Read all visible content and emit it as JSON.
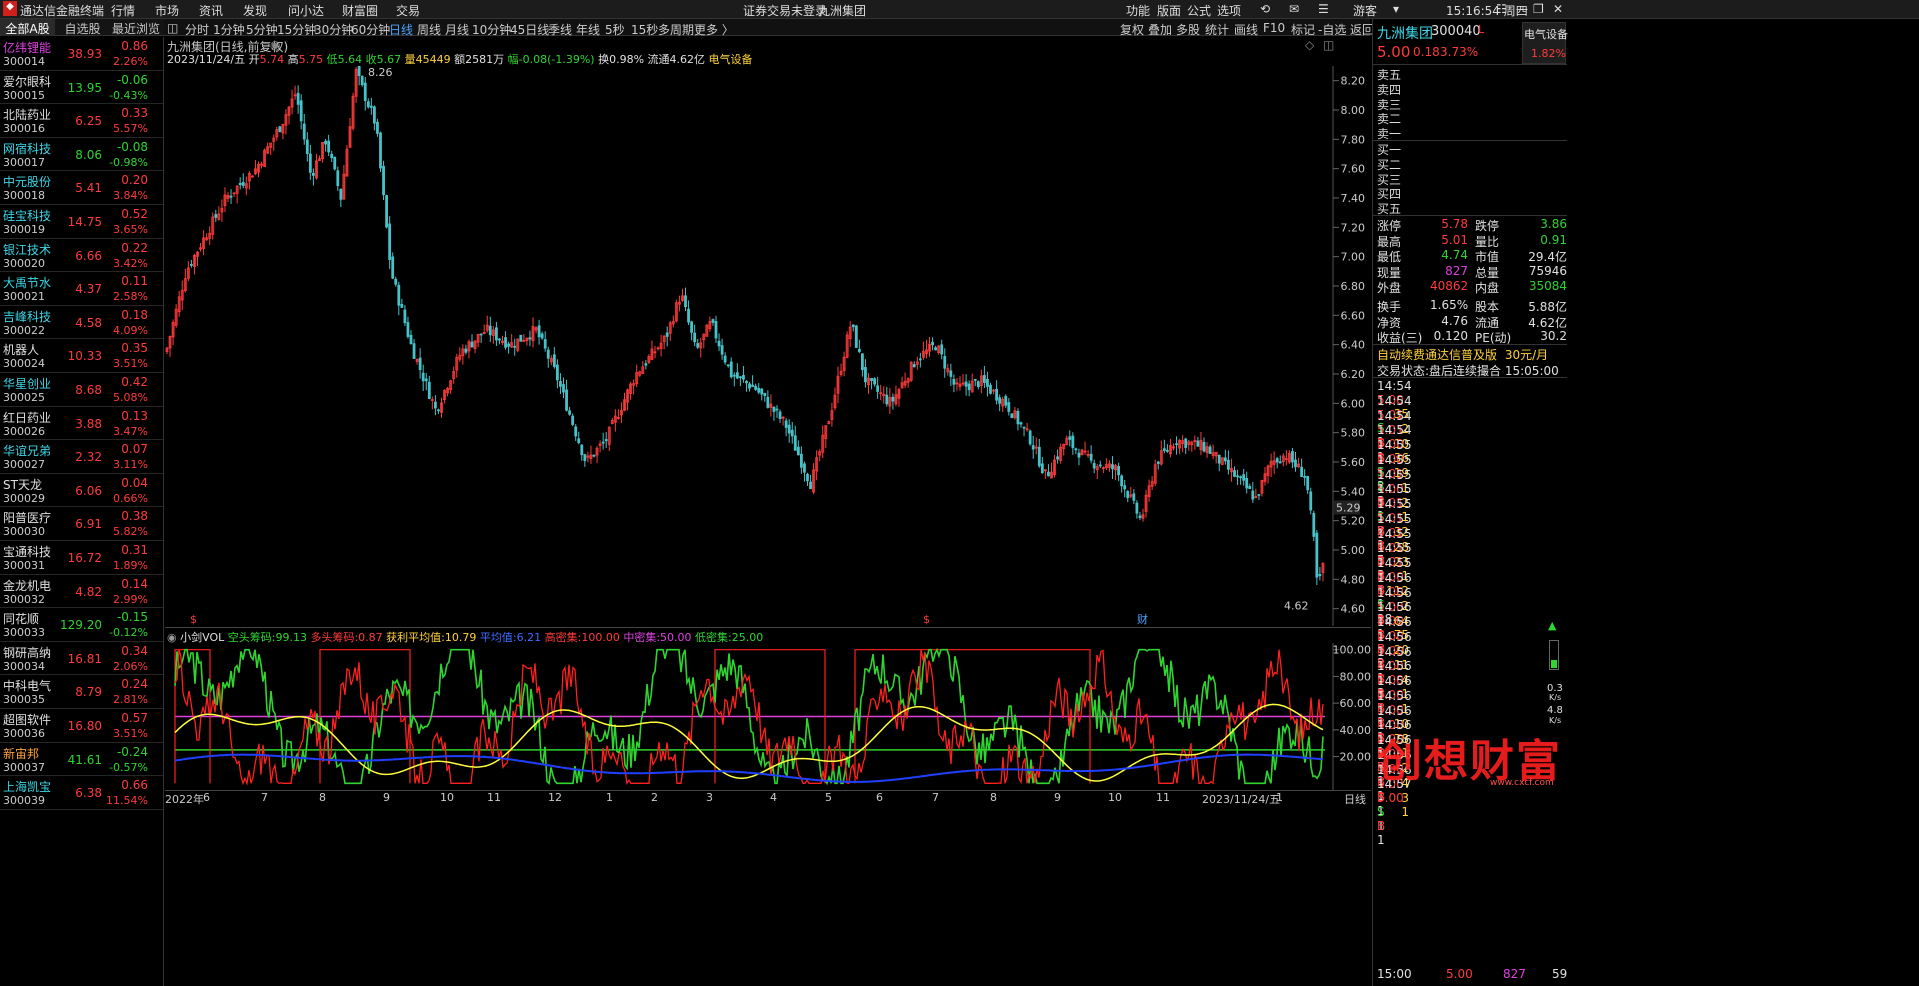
{
  "app": {
    "title": "通达信金融终端",
    "menus": [
      "行情",
      "市场",
      "资讯",
      "发现",
      "问小达",
      "财富圈",
      "交易"
    ],
    "warning": "证券交易未登录",
    "warning_stock": "九洲集团",
    "right_menus": [
      "功能",
      "版面",
      "公式",
      "选项"
    ],
    "user": "游客",
    "clock": "15:16:54 周四"
  },
  "left_tabs": [
    "全部A股",
    "自选股",
    "最近浏览"
  ],
  "stocks": [
    {
      "name": "亿纬锂能",
      "code": "300014",
      "price": "38.93",
      "change": "0.86",
      "pct": "2.26%",
      "nc": "purple",
      "dir": "up"
    },
    {
      "name": "爱尔眼科",
      "code": "300015",
      "price": "13.95",
      "change": "-0.06",
      "pct": "-0.43%",
      "nc": "white",
      "dir": "down"
    },
    {
      "name": "北陆药业",
      "code": "300016",
      "price": "6.25",
      "change": "0.33",
      "pct": "5.57%",
      "nc": "white",
      "dir": "up"
    },
    {
      "name": "网宿科技",
      "code": "300017",
      "price": "8.06",
      "change": "-0.08",
      "pct": "-0.98%",
      "nc": "cyan",
      "dir": "down"
    },
    {
      "name": "中元股份",
      "code": "300018",
      "price": "5.41",
      "change": "0.20",
      "pct": "3.84%",
      "nc": "cyan",
      "dir": "up"
    },
    {
      "name": "硅宝科技",
      "code": "300019",
      "price": "14.75",
      "change": "0.52",
      "pct": "3.65%",
      "nc": "cyan",
      "dir": "up"
    },
    {
      "name": "银江技术",
      "code": "300020",
      "price": "6.66",
      "change": "0.22",
      "pct": "3.42%",
      "nc": "cyan",
      "dir": "up"
    },
    {
      "name": "大禹节水",
      "code": "300021",
      "price": "4.37",
      "change": "0.11",
      "pct": "2.58%",
      "nc": "cyan",
      "dir": "up"
    },
    {
      "name": "吉峰科技",
      "code": "300022",
      "price": "4.58",
      "change": "0.18",
      "pct": "4.09%",
      "nc": "cyan",
      "dir": "up"
    },
    {
      "name": "机器人",
      "code": "300024",
      "price": "10.33",
      "change": "0.35",
      "pct": "3.51%",
      "nc": "white",
      "dir": "up"
    },
    {
      "name": "华星创业",
      "code": "300025",
      "price": "8.68",
      "change": "0.42",
      "pct": "5.08%",
      "nc": "cyan",
      "dir": "up"
    },
    {
      "name": "红日药业",
      "code": "300026",
      "price": "3.88",
      "change": "0.13",
      "pct": "3.47%",
      "nc": "white",
      "dir": "up"
    },
    {
      "name": "华谊兄弟",
      "code": "300027",
      "price": "2.32",
      "change": "0.07",
      "pct": "3.11%",
      "nc": "cyan",
      "dir": "up"
    },
    {
      "name": "ST天龙",
      "code": "300029",
      "price": "6.06",
      "change": "0.04",
      "pct": "0.66%",
      "nc": "white",
      "dir": "up"
    },
    {
      "name": "阳普医疗",
      "code": "300030",
      "price": "6.91",
      "change": "0.38",
      "pct": "5.82%",
      "nc": "white",
      "dir": "up"
    },
    {
      "name": "宝通科技",
      "code": "300031",
      "price": "16.72",
      "change": "0.31",
      "pct": "1.89%",
      "nc": "white",
      "dir": "up"
    },
    {
      "name": "金龙机电",
      "code": "300032",
      "price": "4.82",
      "change": "0.14",
      "pct": "2.99%",
      "nc": "white",
      "dir": "up"
    },
    {
      "name": "同花顺",
      "code": "300033",
      "price": "129.20",
      "change": "-0.15",
      "pct": "-0.12%",
      "nc": "white",
      "dir": "down"
    },
    {
      "name": "钢研高纳",
      "code": "300034",
      "price": "16.81",
      "change": "0.34",
      "pct": "2.06%",
      "nc": "white",
      "dir": "up"
    },
    {
      "name": "中科电气",
      "code": "300035",
      "price": "8.79",
      "change": "0.24",
      "pct": "2.81%",
      "nc": "white",
      "dir": "up"
    },
    {
      "name": "超图软件",
      "code": "300036",
      "price": "16.80",
      "change": "0.57",
      "pct": "3.51%",
      "nc": "white",
      "dir": "up"
    },
    {
      "name": "新宙邦",
      "code": "300037",
      "price": "41.61",
      "change": "-0.24",
      "pct": "-0.57%",
      "nc": "orange",
      "dir": "down"
    },
    {
      "name": "上海凯宝",
      "code": "300039",
      "price": "6.38",
      "change": "0.66",
      "pct": "11.54%",
      "nc": "cyan",
      "dir": "up"
    }
  ],
  "periods": [
    "分时",
    "1分钟",
    "5分钟",
    "15分钟",
    "30分钟",
    "60分钟",
    "日线",
    "周线",
    "月线",
    "10分钟",
    "45日线",
    "季线",
    "年线",
    "5秒",
    "15秒",
    "多周期",
    "更多 〉"
  ],
  "selected_period": "日线",
  "right_tools": [
    "复权",
    "叠加",
    "多股",
    "统计",
    "画线",
    "F10",
    "标记",
    "-自选",
    "返回"
  ],
  "chart_header": {
    "title": "九洲集团(日线,前复权)",
    "date": "2023/11/24/五",
    "open_l": "开",
    "open": "5.74",
    "high_l": "高",
    "high": "5.75",
    "low_l": "低",
    "low": "5.64",
    "close_l": "收",
    "close": "5.67",
    "vol_l": "量",
    "vol": "45449",
    "amt_l": "额",
    "amt": "2581万",
    "range": "幅-0.08(-1.39%)",
    "turnover": "换0.98%",
    "float": "流通4.62亿",
    "sector": "电气设备"
  },
  "price_labels": {
    "max": "8.26",
    "min": "4.62",
    "last": "5.29"
  },
  "y_ticks": [
    "8.20",
    "8.00",
    "7.80",
    "7.60",
    "7.40",
    "7.20",
    "7.00",
    "6.80",
    "6.60",
    "6.40",
    "6.20",
    "6.00",
    "5.80",
    "5.60",
    "5.40",
    "5.20",
    "5.00",
    "4.80",
    "4.60"
  ],
  "markers": {
    "s1": "$",
    "s2": "$",
    "cai": "财"
  },
  "indicator": {
    "name": "小剑VOL",
    "kt_l": "空头筹码:",
    "kt": "99.13",
    "dt_l": "多头筹码:",
    "dt": "0.87",
    "hl_l": "获利平均值:",
    "hl": "10.79",
    "pj_l": "平均值:",
    "pj": "6.21",
    "gm_l": "高密集:",
    "gm": "100.00",
    "zm_l": "中密集:",
    "zm": "50.00",
    "dm_l": "低密集:",
    "dm": "25.00"
  },
  "sub_ticks": [
    "100.00",
    "80.00",
    "60.00",
    "40.00",
    "20.00"
  ],
  "x_labels": [
    "2022年",
    "6",
    "7",
    "8",
    "9",
    "10",
    "11",
    "12",
    "1",
    "2",
    "3",
    "4",
    "5",
    "6",
    "7",
    "8",
    "9",
    "10",
    "11",
    "2023/11/24/五",
    "1"
  ],
  "x_tab": "日线",
  "quote": {
    "name": "九洲集团",
    "code": "300040",
    "tag": "L",
    "price": "5.00",
    "change": "0.18",
    "pct": "3.73%",
    "sector": "电气设备",
    "sector_pct": "1.82%"
  },
  "orderbook": {
    "sell": [
      "卖五",
      "卖四",
      "卖三",
      "卖二",
      "卖一"
    ],
    "buy": [
      "买一",
      "买二",
      "买三",
      "买四",
      "买五"
    ]
  },
  "stats": [
    {
      "l1": "涨停",
      "v1": "5.78",
      "c1": "red",
      "l2": "跌停",
      "v2": "3.86",
      "c2": "green"
    },
    {
      "l1": "最高",
      "v1": "5.01",
      "c1": "red",
      "l2": "量比",
      "v2": "0.91",
      "c2": "green"
    },
    {
      "l1": "最低",
      "v1": "4.74",
      "c1": "green",
      "l2": "市值",
      "v2": "29.4亿",
      "c2": "white"
    },
    {
      "l1": "现量",
      "v1": "827",
      "c1": "purple",
      "l2": "总量",
      "v2": "75946",
      "c2": "white"
    },
    {
      "l1": "外盘",
      "v1": "40862",
      "c1": "red",
      "l2": "内盘",
      "v2": "35084",
      "c2": "green"
    },
    {
      "l1": "换手",
      "v1": "1.65%",
      "c1": "white",
      "l2": "股本",
      "v2": "5.88亿",
      "c2": "white"
    },
    {
      "l1": "净资",
      "v1": "4.76",
      "c1": "white",
      "l2": "流通",
      "v2": "4.62亿",
      "c2": "white"
    },
    {
      "l1": "收益(三)",
      "v1": "0.120",
      "c1": "white",
      "l2": "PE(动)",
      "v2": "30.2",
      "c2": "white"
    }
  ],
  "promo": {
    "text": "自动续费通达信普及版",
    "price": "30元/月"
  },
  "trade_status": {
    "label": "交易状态:",
    "value": "盘后连续撮合 15:05:00"
  },
  "ticks": [
    {
      "t": "14:54",
      "p": "5.00",
      "v": "35",
      "d": "S",
      "n": "1"
    },
    {
      "t": "14:54",
      "p": "5.01",
      "v": "2",
      "d": "B",
      "n": "1"
    },
    {
      "t": "14:54",
      "p": "5.01",
      "v": "10",
      "d": "B",
      "n": "1"
    },
    {
      "t": "14:54",
      "p": "5.00",
      "v": "36",
      "d": "S",
      "n": "2"
    },
    {
      "t": "14:55",
      "p": "5.00",
      "v": "19",
      "d": "S",
      "n": "3"
    },
    {
      "t": "14:55",
      "p": "5.01",
      "v": "1",
      "d": "B",
      "n": "1"
    },
    {
      "t": "14:55",
      "p": "5.00",
      "v": "2",
      "d": "S",
      "n": "2"
    },
    {
      "t": "14:55",
      "p": "5.01",
      "v": "1",
      "d": "B",
      "n": "1"
    },
    {
      "t": "14:55",
      "p": "5.01",
      "v": "32",
      "d": "B",
      "n": "5"
    },
    {
      "t": "14:55",
      "p": "5.01",
      "v": "28",
      "d": "B",
      "n": "3"
    },
    {
      "t": "14:55",
      "p": "5.01",
      "v": "23",
      "d": "B",
      "n": "1"
    },
    {
      "t": "14:55",
      "p": "5.01",
      "v": "1",
      "d": "B",
      "n": "1"
    },
    {
      "t": "14:55",
      "p": "5.00",
      "v": "112",
      "d": "S",
      "n": "28"
    },
    {
      "t": "14:56",
      "p": "5.00",
      "v": "2",
      "d": "B",
      "n": "1"
    },
    {
      "t": "14:56",
      "p": "5.00",
      "v": "64",
      "d": "B",
      "n": "5"
    },
    {
      "t": "14:56",
      "p": "5.00",
      "v": "75",
      "d": "B",
      "n": "2"
    },
    {
      "t": "14:56",
      "p": "5.00",
      "v": "20",
      "d": "B",
      "n": "1"
    },
    {
      "t": "14:56",
      "p": "5.00",
      "v": "11",
      "d": "B",
      "n": "3"
    },
    {
      "t": "14:56",
      "p": "5.00",
      "v": "4",
      "d": "B",
      "n": "1"
    },
    {
      "t": "14:56",
      "p": "5.00",
      "v": "1",
      "d": "B",
      "n": "1"
    },
    {
      "t": "14:56",
      "p": "5.00",
      "v": "1",
      "d": "B",
      "n": "1"
    },
    {
      "t": "14:56",
      "p": "5.00",
      "v": "10",
      "d": "B",
      "n": "1"
    },
    {
      "t": "14:56",
      "p": "5.00",
      "v": "78",
      "d": "B",
      "n": "3"
    },
    {
      "t": "14:56",
      "p": "5.00",
      "v": "1",
      "d": "B",
      "n": "1"
    },
    {
      "t": "14:56",
      "p": "5.00",
      "v": "2",
      "d": "B",
      "n": "1"
    },
    {
      "t": "14:56",
      "p": "5.00",
      "v": "4",
      "d": "B",
      "n": "1"
    },
    {
      "t": "14:56",
      "p": "5.00",
      "v": "3",
      "d": "S",
      "n": "1"
    },
    {
      "t": "14:57",
      "p": "5.00",
      "v": "1",
      "d": "B",
      "n": "1"
    }
  ],
  "last_tick": {
    "t": "15:00",
    "p": "5.00",
    "v": "827",
    "n": "59"
  },
  "speed": {
    "a": "0.3",
    "au": "K/s",
    "b": "4.8",
    "bu": "K/s"
  },
  "watermark": "创想财富",
  "watermark_url": "www.cxcf.com"
}
